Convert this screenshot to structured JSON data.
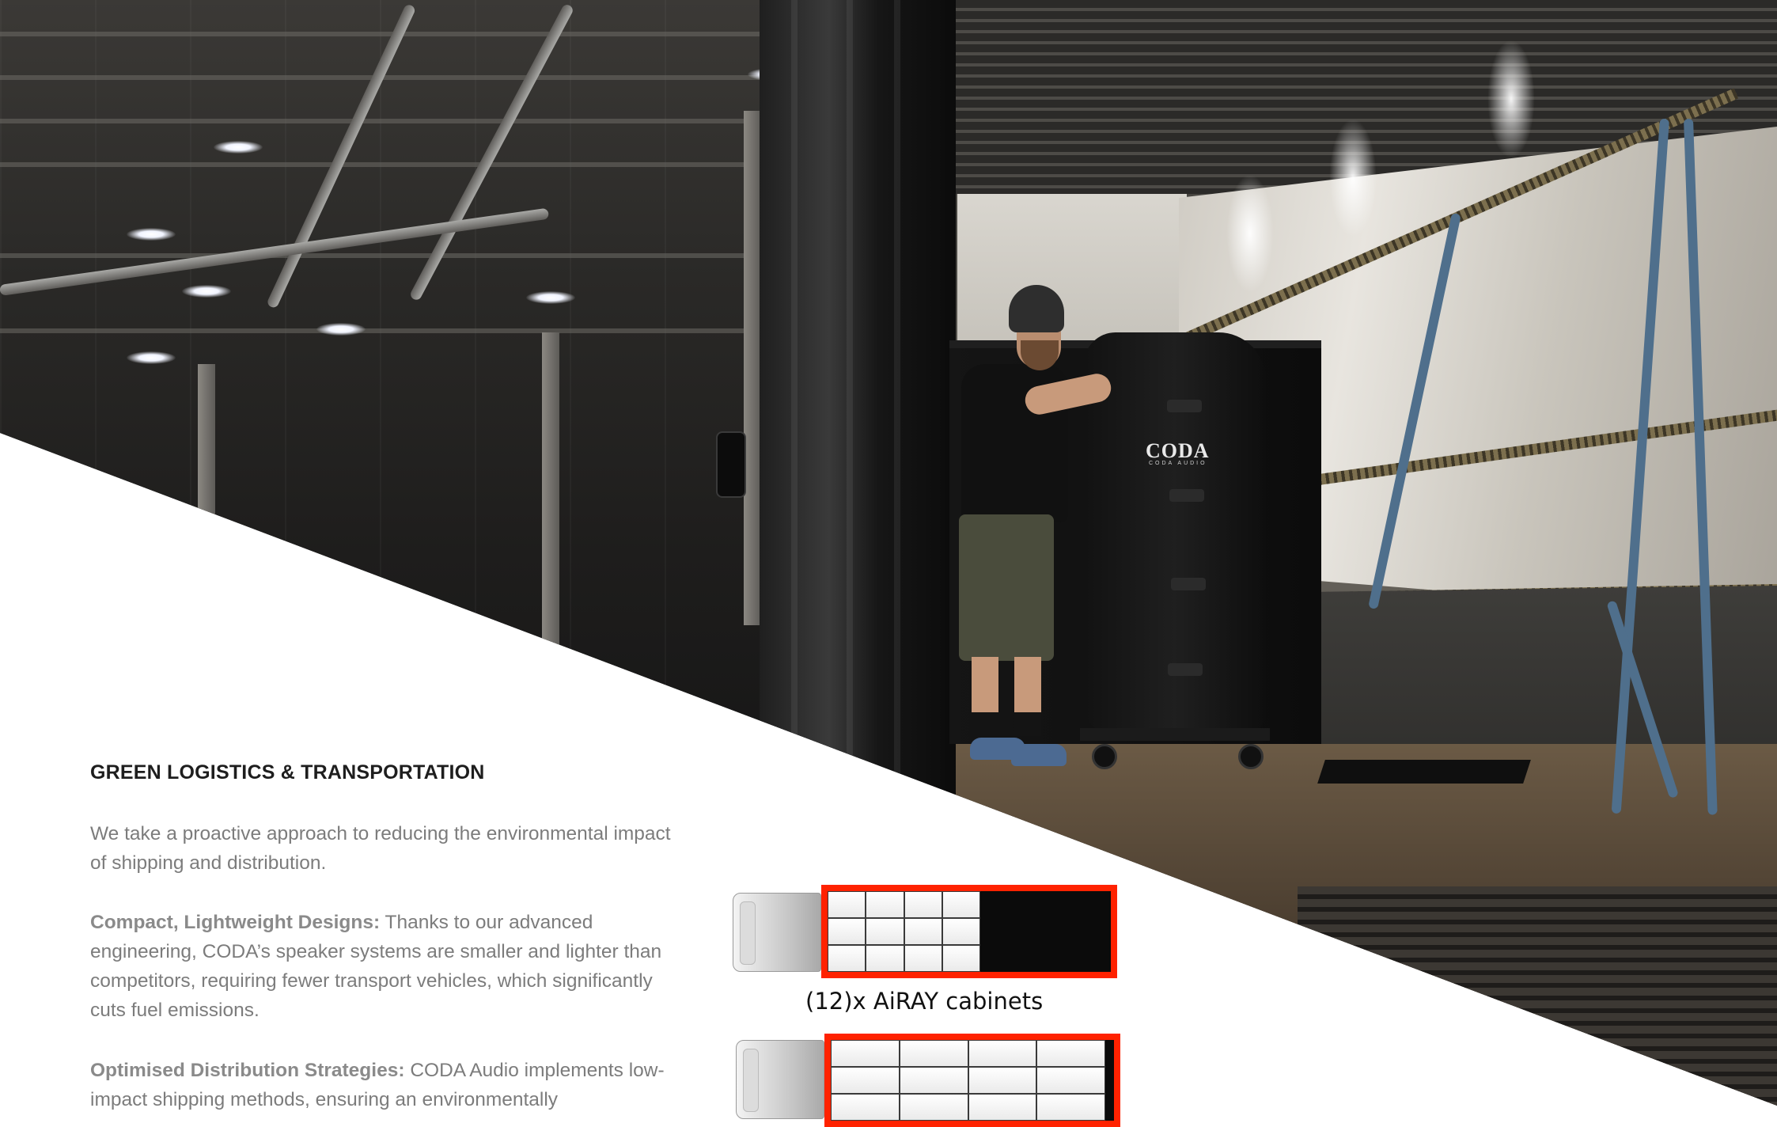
{
  "section": {
    "title": "GREEN LOGISTICS & TRANSPORTATION",
    "intro": "We take a proactive approach to reducing the environmental impact of shipping and distribution.",
    "points": [
      {
        "heading": "Compact, Lightweight Designs:",
        "text": "Thanks to our advanced engineering, CODA’s speaker systems are smaller and lighter than competitors, requiring fewer transport vehicles, which significantly cuts fuel emissions."
      },
      {
        "heading": "Optimised Distribution Strategies:",
        "text": "CODA Audio implements low-impact shipping methods, ensuring an environmentally"
      }
    ]
  },
  "photo": {
    "bag_logo": "CODA",
    "bag_logo_sub": "CODA AUDIO"
  },
  "diagrams": {
    "caption": "(12)x AiRAY cabinets",
    "accent_color": "#ff2200",
    "trucks": [
      {
        "cabinet_columns": 4,
        "cabinet_rows": 3,
        "filled_fraction": 0.54
      },
      {
        "cabinet_columns": 4,
        "cabinet_rows": 3,
        "filled_fraction": 0.97
      }
    ]
  }
}
